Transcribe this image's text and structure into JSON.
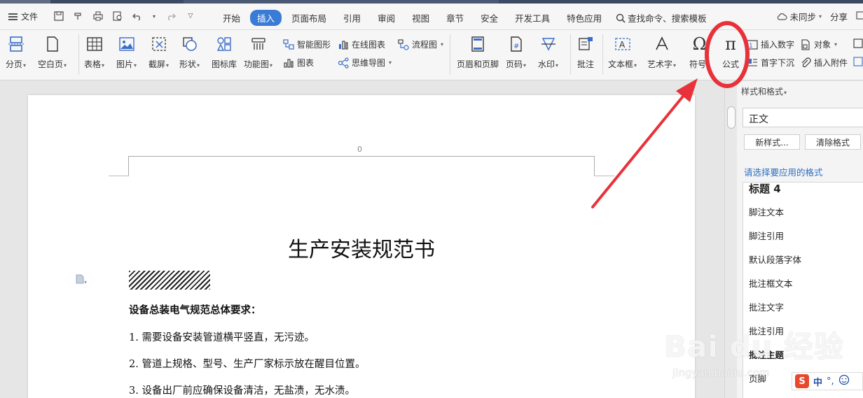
{
  "menu": {
    "file": "文件",
    "tabs": [
      "开始",
      "插入",
      "页面布局",
      "引用",
      "审阅",
      "视图",
      "章节",
      "安全",
      "开发工具",
      "特色应用"
    ],
    "active_tab": "插入",
    "search": "查找命令、搜索模板",
    "sync": "未同步",
    "share": "分享"
  },
  "ribbon": {
    "page_break": "分页",
    "blank_page": "空白页",
    "table": "表格",
    "picture": "图片",
    "screenshot": "截屏",
    "shapes": "形状",
    "icon_lib": "图标库",
    "func_chart": "功能图",
    "smart_art": "智能图形",
    "chart": "图表",
    "online_chart": "在线图表",
    "mind_map": "思维导图",
    "flowchart": "流程图",
    "header_footer": "页眉和页脚",
    "page_number": "页码",
    "watermark": "水印",
    "comment": "批注",
    "textbox": "文本框",
    "art_text": "艺术字",
    "symbol": "符号",
    "formula": "公式",
    "insert_number": "插入数字",
    "object": "对象",
    "drop_cap": "首字下沉",
    "attachment": "插入附件"
  },
  "document": {
    "header_number": "0",
    "title": "生产安装规范书",
    "heading": "设备总装电气规范总体要求：",
    "items": [
      "1. 需要设备安装管道横平竖直，无污迹。",
      "2. 管道上规格、型号、生产厂家标示放在醒目位置。",
      "3. 设备出厂前应确保设备清洁，无盐渍，无水渍。"
    ]
  },
  "style_panel": {
    "title": "样式和格式",
    "current_style": "正文",
    "new_style": "新样式...",
    "clear_format": "清除格式",
    "prompt": "请选择要应用的格式",
    "styles": [
      "标题 4",
      "脚注文本",
      "脚注引用",
      "默认段落字体",
      "批注框文本",
      "批注文字",
      "批注引用",
      "批注主题",
      "页脚"
    ]
  },
  "ime": {
    "logo": "S",
    "mode": "中",
    "punct": "°,"
  },
  "watermark": {
    "brand": "Bai du 经验",
    "url": "jingyan.baidu.com"
  },
  "colors": {
    "accent": "#3a7bd5",
    "annotation": "#e8323a"
  }
}
